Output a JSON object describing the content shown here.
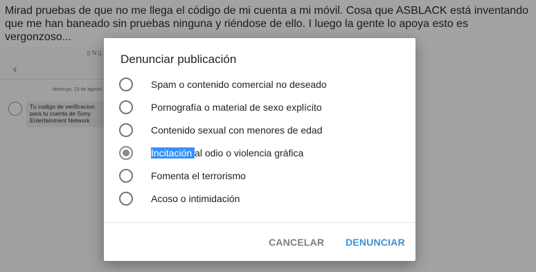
{
  "post": {
    "text": "Mirad pruebas de que no me llega el código de mi cuenta a mi móvil. Cosa que ASBLACK está inventando que me han baneado sin pruebas ninguna y riéndose de ello. I luego la gente lo apoya esto es vergonzoso..."
  },
  "screenshot": {
    "status_icons": "▯ ℕ ▯",
    "back_glyph": "‹",
    "date": "domingo, 19 de agosto",
    "message": "Tu codigo de verificacion\npara tu cuenta de Sony\nEntertainment Network"
  },
  "dialog": {
    "title": "Denunciar publicación",
    "options": [
      {
        "label": "Spam o contenido comercial no deseado",
        "selected": false
      },
      {
        "label": "Pornografía o material de sexo explícito",
        "selected": false
      },
      {
        "label": "Contenido sexual con menores de edad",
        "selected": false
      },
      {
        "label_highlighted": "Incitación ",
        "label_rest": "al odio o violencia gráfica",
        "selected": true
      },
      {
        "label": "Fomenta el terrorismo",
        "selected": false
      },
      {
        "label": "Acoso o intimidación",
        "selected": false
      }
    ],
    "cancel_label": "CANCELAR",
    "report_label": "DENUNCIAR",
    "accent_color": "#3d8fd6",
    "selection_highlight_color": "#3390ff"
  }
}
